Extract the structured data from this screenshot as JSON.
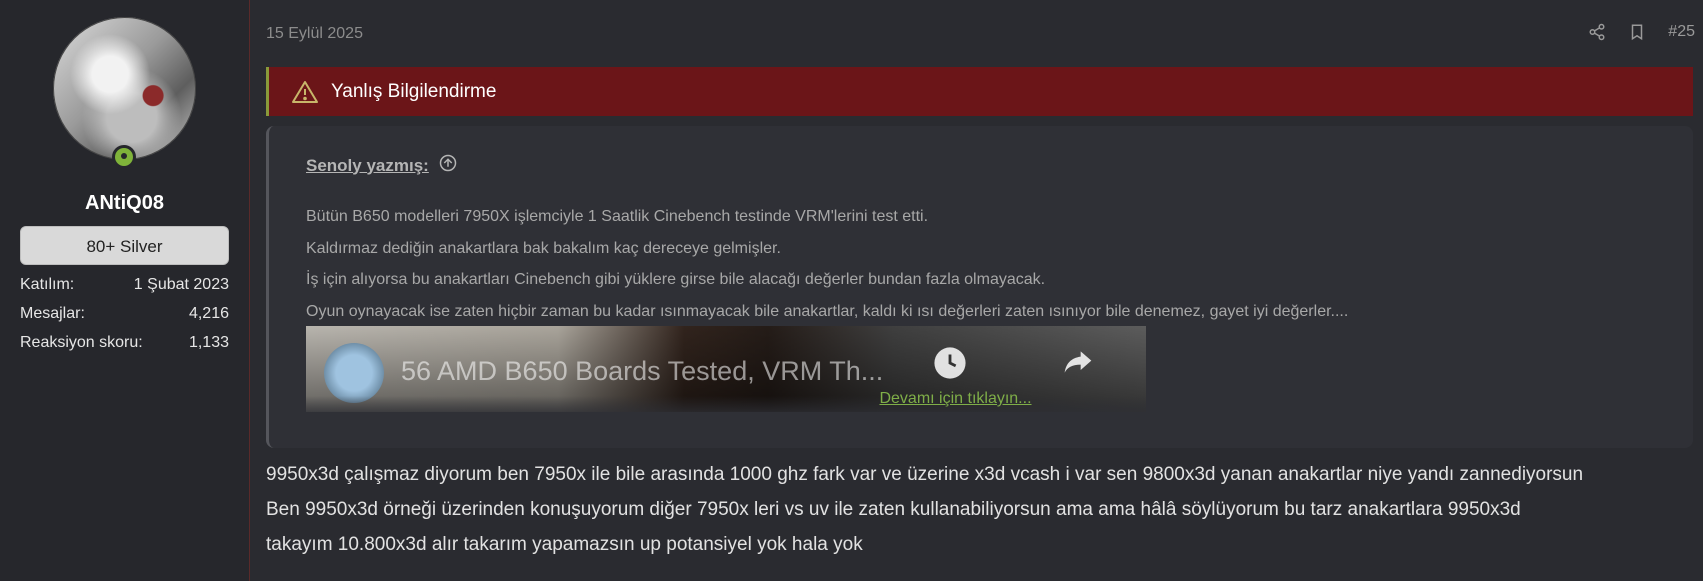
{
  "user": {
    "username": "ANtiQ08",
    "rank_badge": "80+ Silver",
    "stats": [
      {
        "label": "Katılım:",
        "value": "1 Şubat 2023"
      },
      {
        "label": "Mesajlar:",
        "value": "4,216"
      },
      {
        "label": "Reaksiyon skoru:",
        "value": "1,133"
      }
    ]
  },
  "post": {
    "date": "15 Eylül 2025",
    "number": "#25",
    "alert_text": "Yanlış Bilgilendirme",
    "quote": {
      "author": "Senoly yazmış:",
      "lines": [
        "Bütün B650 modelleri 7950X işlemciyle 1 Saatlik Cinebench testinde VRM'lerini test etti.",
        "Kaldırmaz dediğin anakartlara bak bakalım kaç dereceye gelmişler.",
        "İş için alıyorsa bu anakartları Cinebench gibi yüklere girse bile alacağı değerler bundan fazla olmayacak.",
        "Oyun oynayacak ise zaten hiçbir zaman bu kadar ısınmayacak bile anakartlar, kaldı ki ısı değerleri zaten ısınıyor bile denemez, gayet iyi değerler...."
      ],
      "video_title": "56 AMD B650 Boards Tested, VRM Th...",
      "expand_label": "Devamı için tıklayın..."
    },
    "body_lines": [
      "9950x3d çalışmaz diyorum ben 7950x ile bile arasında 1000 ghz fark var ve üzerine x3d vcash i var sen 9800x3d yanan anakartlar niye yandı zannediyorsun",
      "Ben 9950x3d örneği üzerinden konuşuyorum diğer 7950x leri vs uv ile zaten kullanabiliyorsun ama ama hâlâ söylüyorum bu tarz anakartlara 9950x3d",
      "takayım 10.800x3d alır takarım yapamazsın up potansiyel yok hala yok"
    ]
  },
  "colors": {
    "alert_bg": "#6b1518",
    "link_green": "#7fae48",
    "online_green": "#7fb33a"
  },
  "icons": [
    "share-icon",
    "bookmark-icon",
    "warning-icon",
    "arrow-up-circle-icon",
    "clock-icon",
    "share-arrow-icon",
    "online-status-icon"
  ]
}
